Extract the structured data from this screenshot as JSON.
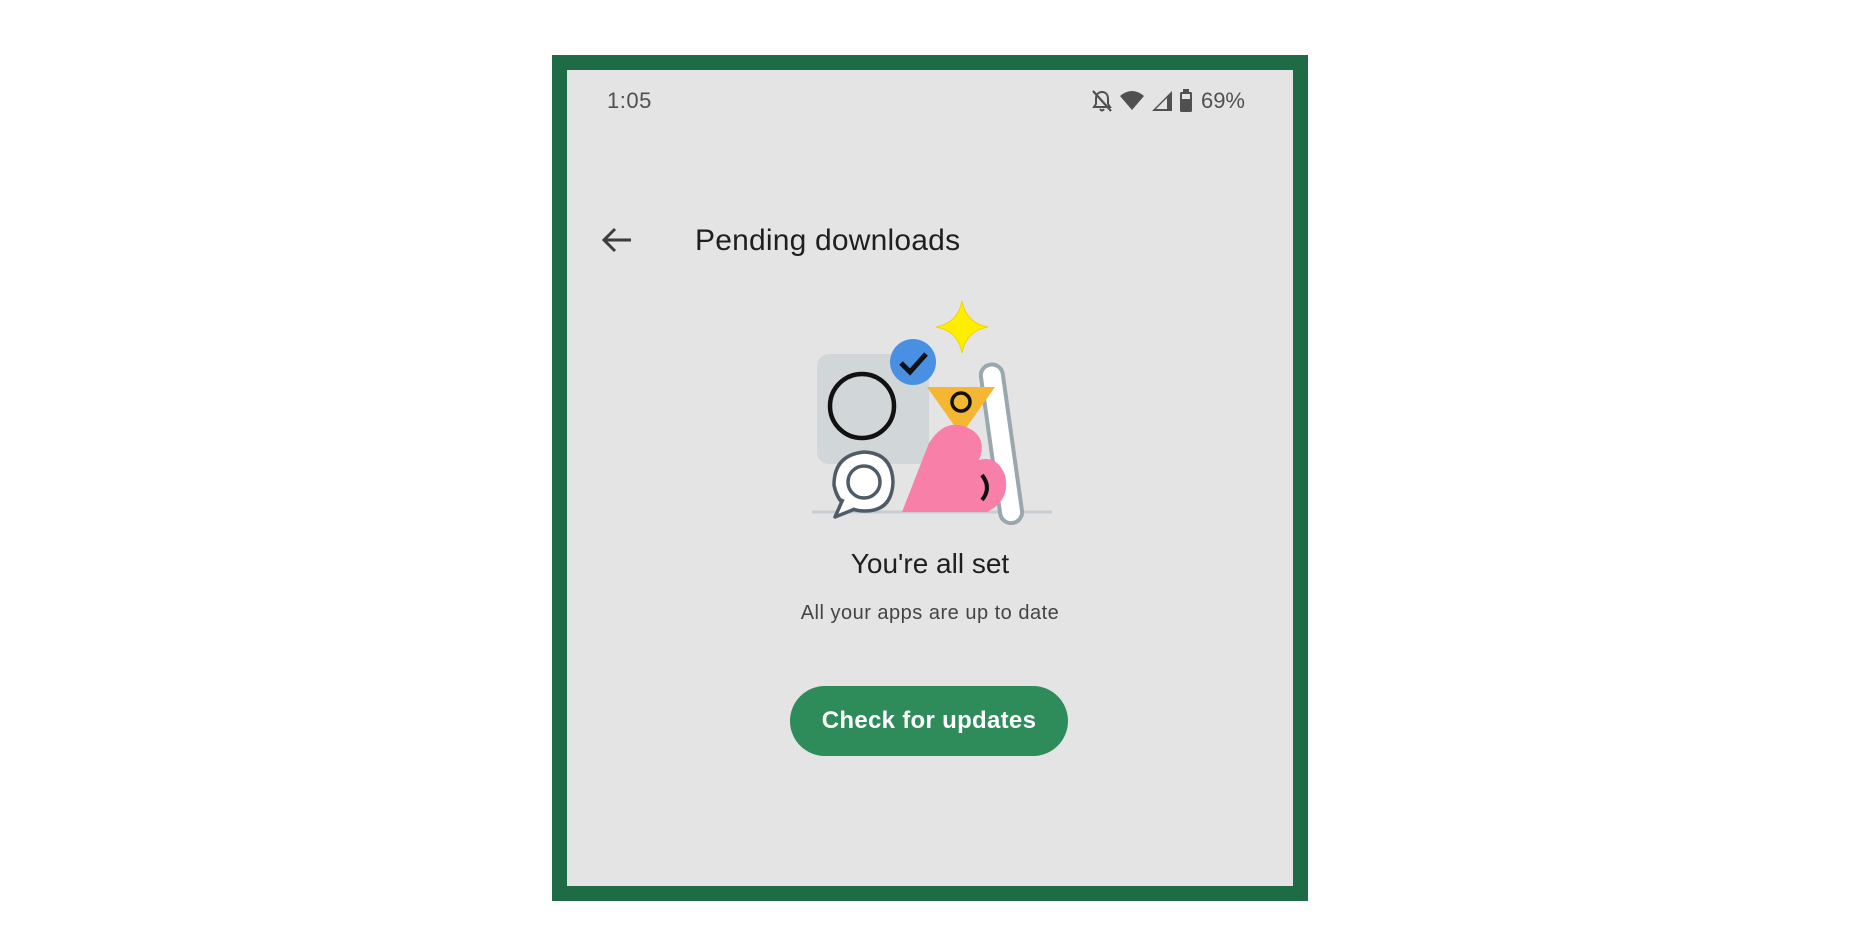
{
  "status_bar": {
    "time": "1:05",
    "battery": "69%",
    "icons": [
      "notifications-off-icon",
      "wifi-icon",
      "cellular-signal-icon",
      "battery-icon"
    ]
  },
  "app_bar": {
    "back_icon": "arrow-left-icon",
    "title": "Pending downloads"
  },
  "empty_state": {
    "illustration": "all-set-illustration",
    "title": "You're all set",
    "subtitle": "All your apps are up to date"
  },
  "actions": {
    "check_updates_label": "Check for updates"
  },
  "colors": {
    "frame": "#1f6b45",
    "background": "#e4e4e4",
    "primary_button": "#2e8b5a",
    "check_badge": "#4a90e2",
    "sparkle": "#ffee00",
    "triangle": "#f5b731",
    "heart": "#f77fa8"
  }
}
